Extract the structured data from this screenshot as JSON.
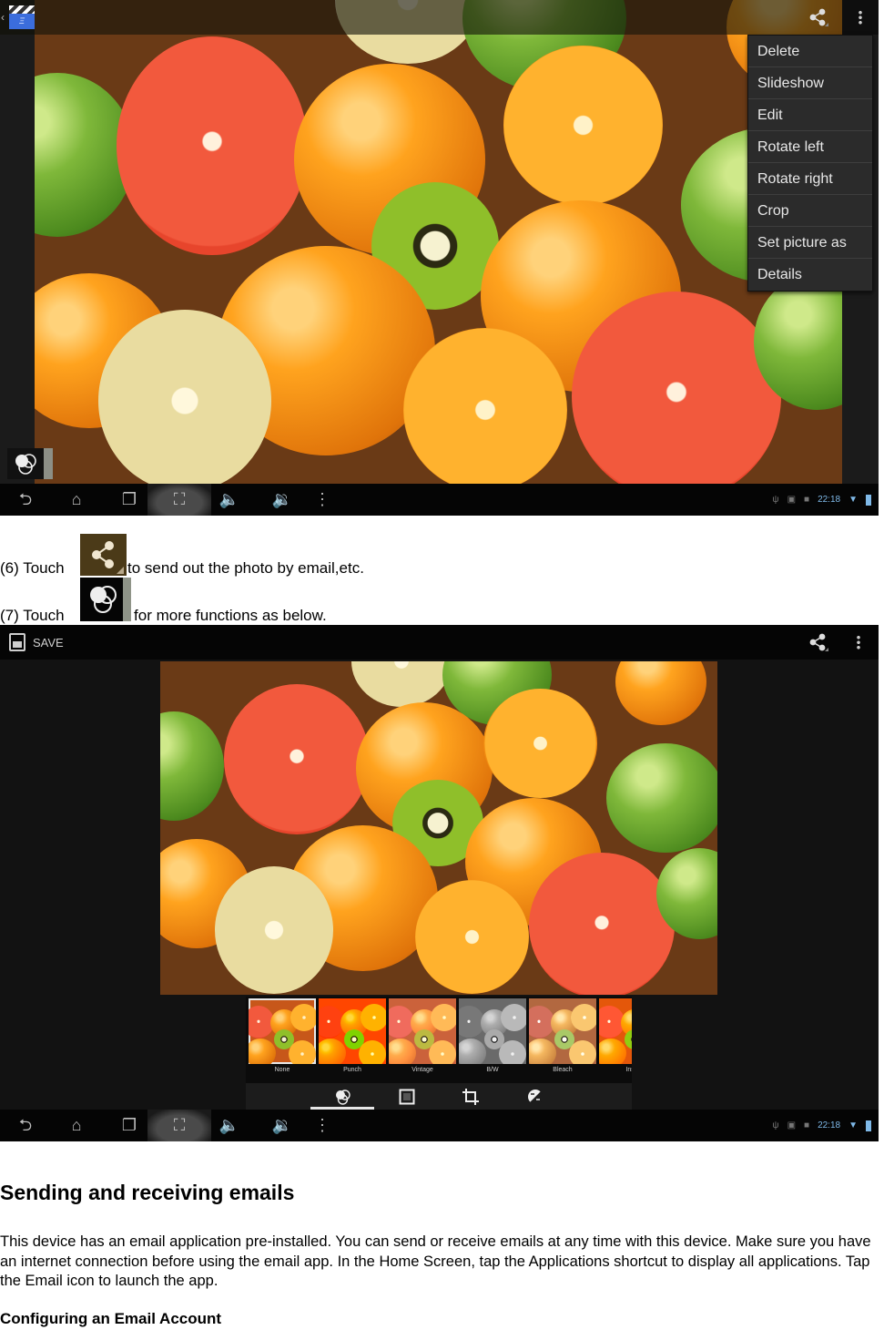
{
  "screenshot_1": {
    "action_bar": {
      "app_icon": "gallery-clapper-icon",
      "share_icon": "share-icon",
      "overflow_icon": "overflow-menu-icon"
    },
    "overflow_menu": {
      "items": [
        {
          "label": "Delete"
        },
        {
          "label": "Slideshow"
        },
        {
          "label": "Edit"
        },
        {
          "label": "Rotate left"
        },
        {
          "label": "Rotate right"
        },
        {
          "label": "Crop"
        },
        {
          "label": "Set picture as"
        },
        {
          "label": "Details"
        }
      ]
    },
    "effects_button_icon": "filter-effects-icon",
    "nav_bar": {
      "buttons": [
        "back-icon",
        "home-icon",
        "recent-apps-icon",
        "screenshot-icon",
        "volume-down-icon",
        "volume-up-icon",
        "menu-icon"
      ],
      "status": {
        "time": "22:18",
        "icons": [
          "usb-icon",
          "image-icon",
          "sd-card-icon",
          "wifi-icon",
          "battery-icon"
        ]
      }
    }
  },
  "captions": [
    {
      "prefix": "(6) Touch",
      "suffix": "to send out the photo by email,etc.",
      "icon": "share-icon"
    },
    {
      "prefix": "(7) Touch",
      "suffix": "for more functions as below.",
      "icon": "filter-effects-icon"
    }
  ],
  "screenshot_2": {
    "action_bar": {
      "save_label": "SAVE",
      "share_icon": "share-icon",
      "overflow_icon": "overflow-menu-icon"
    },
    "filters": [
      {
        "label": "None",
        "selected": true
      },
      {
        "label": "Punch",
        "selected": false
      },
      {
        "label": "Vintage",
        "selected": false
      },
      {
        "label": "B/W",
        "selected": false
      },
      {
        "label": "Bleach",
        "selected": false
      },
      {
        "label": "Insta",
        "selected": false
      }
    ],
    "editor_tabs": [
      {
        "icon": "filters-icon",
        "active": true
      },
      {
        "icon": "border-frame-icon",
        "active": false
      },
      {
        "icon": "crop-icon",
        "active": false
      },
      {
        "icon": "exposure-icon",
        "active": false
      }
    ],
    "nav_bar": {
      "status": {
        "time": "22:18"
      }
    }
  },
  "section": {
    "heading": "Sending and receiving emails",
    "paragraph": "This device has an email application pre-installed. You can send or receive emails at any time with this device. Make sure you have an internet connection before using the email app. In the Home Screen, tap the Applications shortcut to display all applications. Tap the Email icon to launch the app.",
    "subheading": "Configuring an Email Account"
  }
}
